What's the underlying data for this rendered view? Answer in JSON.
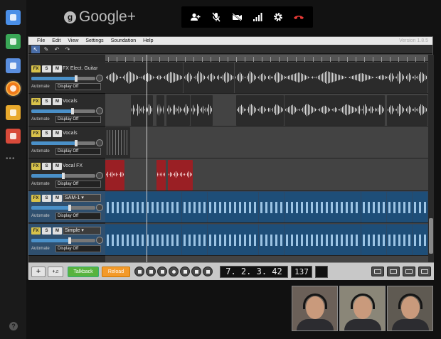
{
  "brand": {
    "name": "Google+",
    "logo_glyph": "g"
  },
  "sidebar": {
    "apps": [
      {
        "icon": "chat-app-icon",
        "color": "#4a8fe8"
      },
      {
        "icon": "share-app-icon",
        "color": "#3aa757"
      },
      {
        "icon": "camera-app-icon",
        "color": "#5a8ede"
      },
      {
        "icon": "soundation-app-icon",
        "color": "#f07a1a",
        "active": true
      },
      {
        "icon": "effects-app-icon",
        "color": "#e8a92c"
      },
      {
        "icon": "games-app-icon",
        "color": "#d84a3a"
      }
    ],
    "more_glyph": "•••",
    "help_glyph": "?"
  },
  "hangout_controls": [
    {
      "icon": "add-person-icon"
    },
    {
      "icon": "mic-muted-icon"
    },
    {
      "icon": "camera-off-icon"
    },
    {
      "icon": "signal-bars-icon"
    },
    {
      "icon": "gear-icon"
    },
    {
      "icon": "hang-up-icon",
      "color": "#e53935"
    }
  ],
  "daw": {
    "menu": [
      "File",
      "Edit",
      "View",
      "Settings",
      "Soundation",
      "Help"
    ],
    "version": "Version 1.8.5",
    "tools": [
      {
        "icon": "pointer-tool-icon",
        "glyph": "↖",
        "active": true
      },
      {
        "icon": "pencil-tool-icon",
        "glyph": "✎"
      },
      {
        "icon": "undo-icon",
        "glyph": "↶"
      },
      {
        "icon": "redo-icon",
        "glyph": "↷"
      }
    ],
    "tracks": [
      {
        "name": "FX Elect. Guitar",
        "named_select": false,
        "automate_label": "Automate",
        "automate_value": "Display Off",
        "volume": 0.7,
        "header_bg": "#2b2b2b"
      },
      {
        "name": "Vocals",
        "named_select": false,
        "automate_label": "Automate",
        "automate_value": "Display Off",
        "volume": 0.65,
        "header_bg": "#2b2b2b"
      },
      {
        "name": "Vocals",
        "named_select": false,
        "automate_label": "Automate",
        "automate_value": "Display Off",
        "volume": 0.7,
        "header_bg": "#2b2b2b"
      },
      {
        "name": "Vocal FX",
        "named_select": false,
        "automate_label": "Automate",
        "automate_value": "Display Off",
        "volume": 0.5,
        "header_bg": "#2b2b2b"
      },
      {
        "name": "SAM-1",
        "named_select": true,
        "automate_label": "Automate",
        "automate_value": "Display Off",
        "volume": 0.6,
        "header_bg": "#2f4f6e"
      },
      {
        "name": "Simple",
        "named_select": true,
        "automate_label": "Automate",
        "automate_value": "Display Off",
        "volume": 0.6,
        "header_bg": "#2f4f6e"
      }
    ],
    "button_labels": {
      "fx": "FX",
      "solo": "S",
      "mute": "M"
    },
    "transport": {
      "add_track": "+",
      "add_instrument": "+♫",
      "talkback": "Talkback",
      "reload": "Reload",
      "position": "7. 2. 3.  42",
      "tempo": "137"
    }
  },
  "video_participants": [
    {
      "icon": "participant-1-video",
      "bg": "#6b6058"
    },
    {
      "icon": "participant-2-video",
      "bg": "#8a8678"
    },
    {
      "icon": "participant-3-video",
      "bg": "#5f5a52"
    }
  ]
}
